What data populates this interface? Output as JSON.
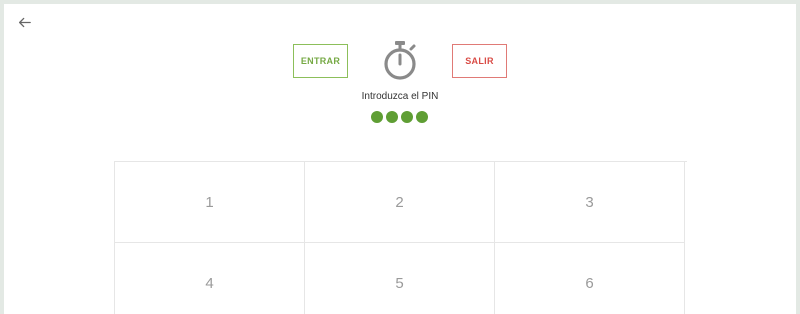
{
  "header": {
    "back_icon": "arrow-left-icon"
  },
  "actions": {
    "enter_label": "ENTRAR",
    "exit_label": "SALIR",
    "enter_color": "#76a944",
    "exit_color": "#d94b45"
  },
  "timer": {
    "icon": "stopwatch-icon"
  },
  "pin": {
    "label": "Introduzca el PIN",
    "digits_entered": 4,
    "dot_color": "#5f9e34"
  },
  "keypad": {
    "keys": [
      "1",
      "2",
      "3",
      "4",
      "5",
      "6"
    ]
  }
}
